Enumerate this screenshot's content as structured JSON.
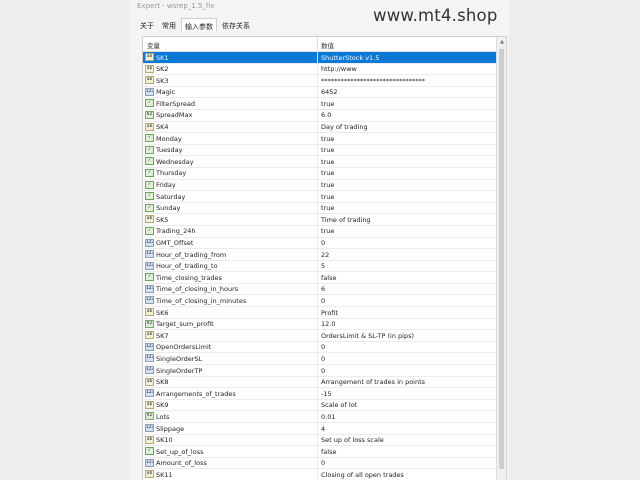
{
  "window": {
    "title": "Expert - wsrep_1.5_fix",
    "tabs": [
      "关于",
      "常用",
      "输入参数",
      "依存关系"
    ],
    "active_tab": 2,
    "watermark": "www.mt4.shop"
  },
  "table": {
    "headers": {
      "name": "变量",
      "value": "数值"
    },
    "selected_row": 0,
    "rows": [
      {
        "type": "str",
        "name": "SK1",
        "value": "ShutterStock v1.5"
      },
      {
        "type": "str",
        "name": "SK2",
        "value": "http://www"
      },
      {
        "type": "str",
        "name": "SK3",
        "value": "********************************"
      },
      {
        "type": "int",
        "name": "Magic",
        "value": "6452"
      },
      {
        "type": "bool",
        "name": "FilterSpread",
        "value": "true"
      },
      {
        "type": "dbl",
        "name": "SpreadMax",
        "value": "6.0"
      },
      {
        "type": "str",
        "name": "SK4",
        "value": "Day of trading"
      },
      {
        "type": "bool",
        "name": "Monday",
        "value": "true"
      },
      {
        "type": "bool",
        "name": "Tuesday",
        "value": "true"
      },
      {
        "type": "bool",
        "name": "Wednesday",
        "value": "true"
      },
      {
        "type": "bool",
        "name": "Thursday",
        "value": "true"
      },
      {
        "type": "bool",
        "name": "Friday",
        "value": "true"
      },
      {
        "type": "bool",
        "name": "Saturday",
        "value": "true"
      },
      {
        "type": "bool",
        "name": "Sunday",
        "value": "true"
      },
      {
        "type": "str",
        "name": "SK5",
        "value": "Time of trading"
      },
      {
        "type": "bool",
        "name": "Trading_24h",
        "value": "true"
      },
      {
        "type": "int",
        "name": "GMT_Offset",
        "value": "0"
      },
      {
        "type": "int",
        "name": "Hour_of_trading_from",
        "value": "22"
      },
      {
        "type": "int",
        "name": "Hour_of_trading_to",
        "value": "5"
      },
      {
        "type": "bool",
        "name": "Time_closing_trades",
        "value": "false"
      },
      {
        "type": "int",
        "name": "Time_of_closing_in_hours",
        "value": "6"
      },
      {
        "type": "int",
        "name": "Time_of_closing_in_minutes",
        "value": "0"
      },
      {
        "type": "str",
        "name": "SK6",
        "value": "Profit"
      },
      {
        "type": "dbl",
        "name": "Target_sum_profit",
        "value": "12.0"
      },
      {
        "type": "str",
        "name": "SK7",
        "value": "OrdersLimit & SL-TP (in pips)"
      },
      {
        "type": "int",
        "name": "OpenOrdersLimit",
        "value": "0"
      },
      {
        "type": "int",
        "name": "SingleOrderSL",
        "value": "0"
      },
      {
        "type": "int",
        "name": "SingleOrderTP",
        "value": "0"
      },
      {
        "type": "str",
        "name": "SK8",
        "value": "Arrangement of trades in points"
      },
      {
        "type": "int",
        "name": "Arrangements_of_trades",
        "value": "-15"
      },
      {
        "type": "str",
        "name": "SK9",
        "value": "Scale of lot"
      },
      {
        "type": "dbl",
        "name": "Lots",
        "value": "0.01"
      },
      {
        "type": "int",
        "name": "Slippage",
        "value": "4"
      },
      {
        "type": "str",
        "name": "SK10",
        "value": "Set up of loss scale"
      },
      {
        "type": "bool",
        "name": "Set_up_of_loss",
        "value": "false"
      },
      {
        "type": "int",
        "name": "Amount_of_loss",
        "value": "0"
      },
      {
        "type": "str",
        "name": "SK11",
        "value": "Closing of all open trades"
      }
    ]
  },
  "icon_glyphs": {
    "int": "123",
    "str": "ab",
    "dbl": "V2",
    "bool": "✓"
  },
  "colors": {
    "selection": "#0a78d7"
  }
}
